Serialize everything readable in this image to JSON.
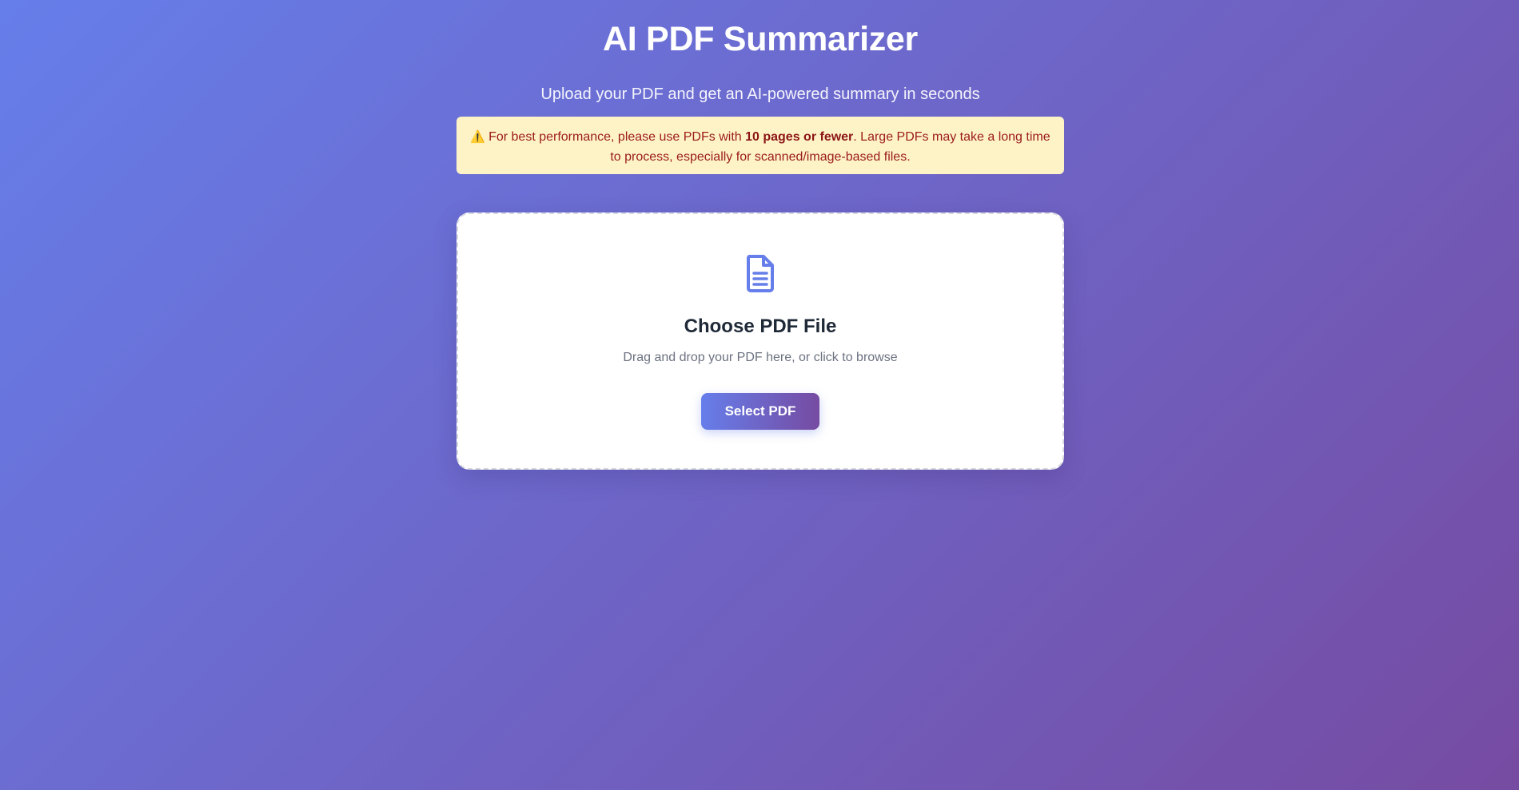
{
  "header": {
    "title": "AI PDF Summarizer",
    "subtitle": "Upload your PDF and get an AI-powered summary in seconds"
  },
  "warning": {
    "icon": "warning-icon",
    "text_before": "For best performance, please use PDFs with ",
    "emphasis": "10 pages or fewer",
    "text_after": ". Large PDFs may take a long time to process, especially for scanned/image-based files."
  },
  "upload": {
    "icon": "file-document-icon",
    "title": "Choose PDF File",
    "instructions": "Drag and drop your PDF here, or click to browse",
    "button_label": "Select PDF"
  },
  "colors": {
    "gradient_start": "#667eea",
    "gradient_end": "#764ba2",
    "warning_bg": "#fef3c7",
    "warning_text": "#9a1b1b"
  }
}
